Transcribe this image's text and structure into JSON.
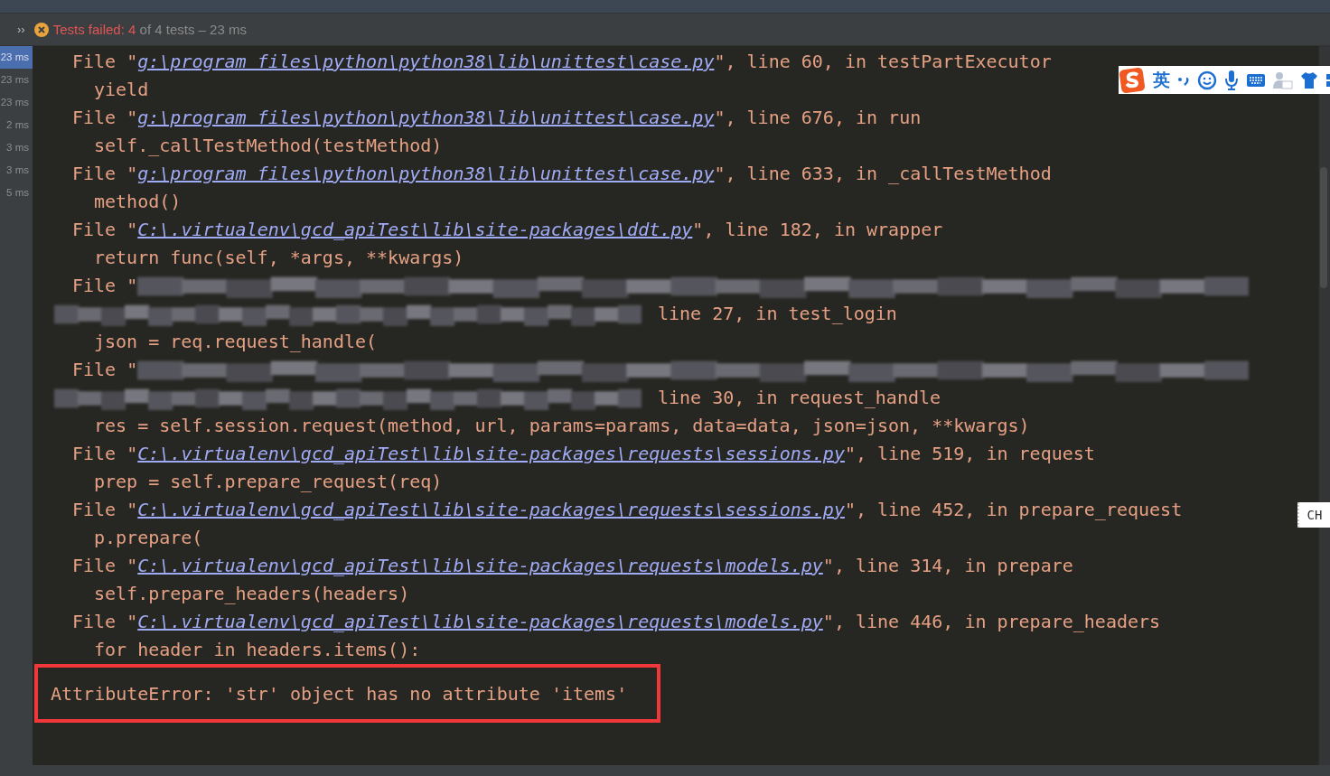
{
  "toolbar": {
    "chevron": "››",
    "status": "Tests failed:",
    "failed": "4",
    "summary": "of 4 tests – 23 ms"
  },
  "durations": [
    {
      "text": "23 ms",
      "selected": true
    },
    {
      "text": "23 ms",
      "selected": false
    },
    {
      "text": "23 ms",
      "selected": false
    },
    {
      "text": "2 ms",
      "selected": false
    },
    {
      "text": "3 ms",
      "selected": false
    },
    {
      "text": "3 ms",
      "selected": false
    },
    {
      "text": "5 ms",
      "selected": false
    }
  ],
  "console": {
    "lines": [
      {
        "kind": "file",
        "prefix": "File \"",
        "path": "g:\\program files\\python\\python38\\lib\\unittest\\case.py",
        "rest": "\", line 60, in testPartExecutor"
      },
      {
        "kind": "code",
        "text": "yield"
      },
      {
        "kind": "file",
        "prefix": "File \"",
        "path": "g:\\program files\\python\\python38\\lib\\unittest\\case.py",
        "rest": "\", line 676, in run"
      },
      {
        "kind": "code",
        "text": "self._callTestMethod(testMethod)"
      },
      {
        "kind": "file",
        "prefix": "File \"",
        "path": "g:\\program files\\python\\python38\\lib\\unittest\\case.py",
        "rest": "\", line 633, in _callTestMethod"
      },
      {
        "kind": "code",
        "text": "method()"
      },
      {
        "kind": "file",
        "prefix": "File \"",
        "path": "C:\\.virtualenv\\gcd_apiTest\\lib\\site-packages\\ddt.py",
        "rest": "\", line 182, in wrapper"
      },
      {
        "kind": "code",
        "text": "return func(self, *args, **kwargs)"
      },
      {
        "kind": "blurred_start",
        "text": "File \""
      },
      {
        "kind": "blurred_end",
        "text": "line 27, in test_login"
      },
      {
        "kind": "code",
        "text": "json = req.request_handle("
      },
      {
        "kind": "blurred_start",
        "text": "File \""
      },
      {
        "kind": "blurred_end",
        "text": "line 30, in request_handle"
      },
      {
        "kind": "code",
        "text": "res = self.session.request(method, url, params=params, data=data, json=json, **kwargs)"
      },
      {
        "kind": "file",
        "prefix": "File \"",
        "path": "C:\\.virtualenv\\gcd_apiTest\\lib\\site-packages\\requests\\sessions.py",
        "rest": "\", line 519, in request"
      },
      {
        "kind": "code",
        "text": "prep = self.prepare_request(req)"
      },
      {
        "kind": "file",
        "prefix": "File \"",
        "path": "C:\\.virtualenv\\gcd_apiTest\\lib\\site-packages\\requests\\sessions.py",
        "rest": "\", line 452, in prepare_request"
      },
      {
        "kind": "code",
        "text": "p.prepare("
      },
      {
        "kind": "file",
        "prefix": "File \"",
        "path": "C:\\.virtualenv\\gcd_apiTest\\lib\\site-packages\\requests\\models.py",
        "rest": "\", line 314, in prepare"
      },
      {
        "kind": "code",
        "text": "self.prepare_headers(headers)"
      },
      {
        "kind": "file",
        "prefix": "File \"",
        "path": "C:\\.virtualenv\\gcd_apiTest\\lib\\site-packages\\requests\\models.py",
        "rest": "\", line 446, in prepare_headers"
      },
      {
        "kind": "code",
        "text": "for header in headers.items():"
      }
    ],
    "error": "AttributeError: 'str' object has no attribute 'items'"
  },
  "ime_toolbar": {
    "language": "英"
  },
  "ime_indicator": "CH"
}
